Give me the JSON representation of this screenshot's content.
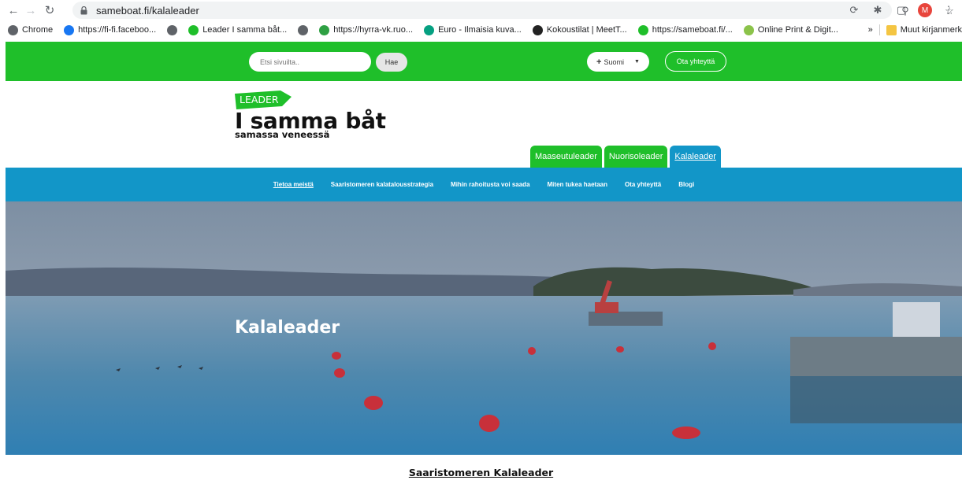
{
  "browser": {
    "url": "sameboat.fi/kalaleader",
    "profile_initial": "M"
  },
  "bookmarks": [
    {
      "label": "Chrome",
      "color": "#5f6368"
    },
    {
      "label": "https://fi-fi.faceboo...",
      "color": "#1877f2"
    },
    {
      "label": "",
      "color": "#5f6368"
    },
    {
      "label": "Leader I samma båt...",
      "color": "#1fbf2a"
    },
    {
      "label": "",
      "color": "#5f6368"
    },
    {
      "label": "https://hyrra-vk.ruo...",
      "color": "#2ea043"
    },
    {
      "label": "Euro - Ilmaisia kuva...",
      "color": "#05a081"
    },
    {
      "label": "Kokoustilat | MeetT...",
      "color": "#222222"
    },
    {
      "label": "https://sameboat.fi/...",
      "color": "#1fbf2a"
    },
    {
      "label": "Online Print & Digit...",
      "color": "#8bc34a"
    }
  ],
  "bookmarks_overflow": "»",
  "bookmarks_other": "Muut kirjanmerk",
  "topbar": {
    "search_placeholder": "Etsi sivuilta..",
    "search_button": "Hae",
    "language": "Suomi",
    "contact_button": "Ota yhteyttä"
  },
  "logo": {
    "tag": "LEADER",
    "title": "I samma båt",
    "subtitle": "samassa veneessä"
  },
  "tabs": [
    {
      "label": "Maaseutuleader",
      "active": false
    },
    {
      "label": "Nuorisoleader",
      "active": false
    },
    {
      "label": "Kalaleader",
      "active": true
    }
  ],
  "nav": [
    {
      "label": "Tietoa meistä",
      "active": true
    },
    {
      "label": "Saaristomeren kalatalousstrategia",
      "active": false
    },
    {
      "label": "Mihin rahoitusta voi saada",
      "active": false
    },
    {
      "label": "Miten tukea haetaan",
      "active": false
    },
    {
      "label": "Ota yhteyttä",
      "active": false
    },
    {
      "label": "Blogi",
      "active": false
    }
  ],
  "hero": {
    "title": "Kalaleader"
  },
  "section_heading": "Saaristomeren Kalaleader",
  "colors": {
    "green": "#1fbf2a",
    "blue": "#1296c8"
  }
}
